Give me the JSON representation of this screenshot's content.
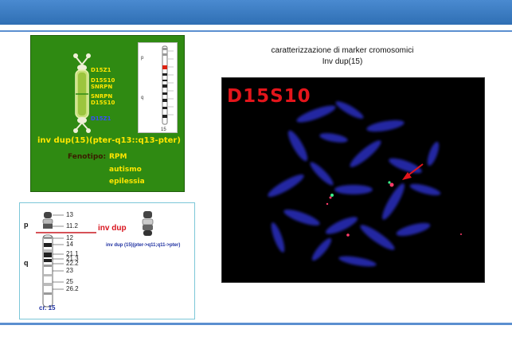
{
  "panel_green": {
    "markers": [
      "D15Z1",
      "D15S10",
      "SNRPN",
      "SNRPN",
      "D15S10",
      "D15Z1"
    ],
    "inv_label": "inv dup(15)(pter-q13::q13-pter)",
    "fenotipo_label": "Fenotipo:",
    "fenotipo_items": [
      "RPM",
      "autismo",
      "epilessia"
    ],
    "ideogram_p": "p",
    "ideogram_q": "q",
    "ideogram_number": "15"
  },
  "panel_ideogram": {
    "arm_p": "p",
    "arm_q": "q",
    "bands": [
      "13",
      "11.2",
      "12",
      "14",
      "21.1",
      "21.3",
      "22.2",
      "23",
      "25",
      "26.2"
    ],
    "inv_dup_label": "inv dup",
    "inv_dup_note": "inv dup (15)(pter->q11;q11->pter)",
    "chromosome_label": "cr. 15"
  },
  "caption": {
    "line1": "caratterizzazione di marker cromosomici",
    "line2": "Inv dup(15)"
  },
  "fish": {
    "probe_label": "D15S10"
  }
}
